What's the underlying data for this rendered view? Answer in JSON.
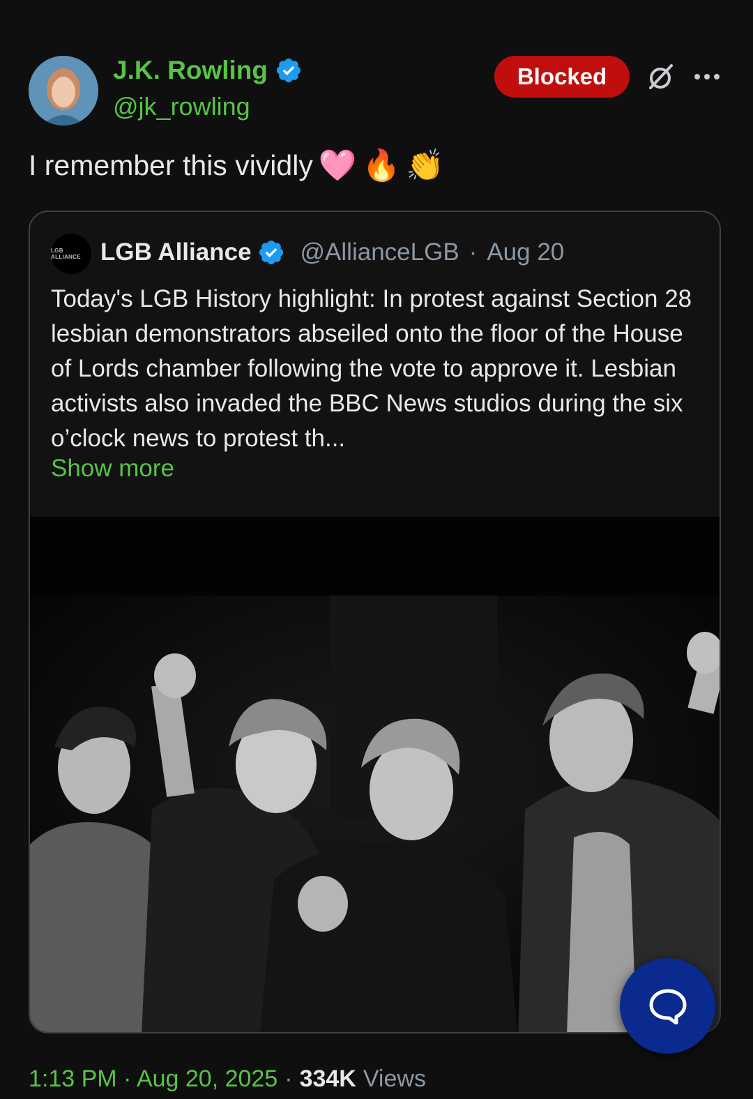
{
  "tweet": {
    "author_name": "J.K. Rowling",
    "author_handle": "@jk_rowling",
    "blocked_label": "Blocked",
    "text": "I remember this vividly",
    "emojis": [
      "🩷",
      "🔥",
      "👏"
    ],
    "timestamp": "1:13 PM · Aug 20, 2025",
    "views_separator": "·",
    "views_count": "334K",
    "views_label": "Views"
  },
  "quote": {
    "avatar_label": "LGB ALLIANCE",
    "name": "LGB Alliance",
    "handle": "@AllianceLGB",
    "date_separator": "·",
    "date": "Aug 20",
    "body": "Today's LGB History highlight: In protest against Section 28 lesbian demonstrators abseiled onto the floor of the House of Lords chamber following the vote to approve it. Lesbian activists also invaded the BBC News studios during the six o’clock news to protest th...",
    "show_more": "Show more"
  },
  "icons": {
    "verified": "verified-badge-icon",
    "grok": "grok-icon",
    "more": "more-options-icon",
    "reply_fab": "reply-bubble-icon"
  },
  "colors": {
    "background": "#0f0f0f",
    "accent_green": "#57c446",
    "blocked_red": "#c00e0e",
    "verified_cyan": "#1d9bf0",
    "fab_blue": "#0b2a8f"
  }
}
